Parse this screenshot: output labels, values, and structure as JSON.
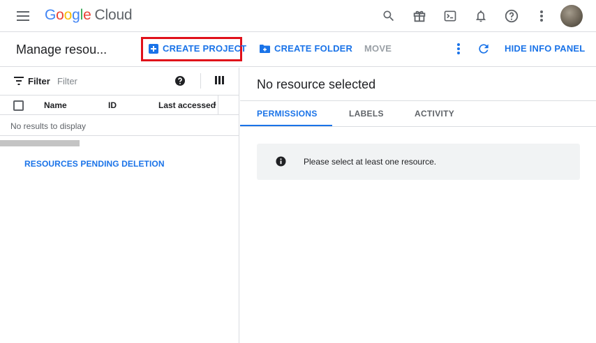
{
  "app": {
    "logo_letters": [
      "G",
      "o",
      "o",
      "g",
      "l",
      "e"
    ],
    "logo_suffix": "Cloud",
    "icons": [
      "menu-icon",
      "search-icon",
      "gift-icon",
      "terminal-icon",
      "bell-icon",
      "help-icon",
      "more-vert-icon",
      "avatar"
    ]
  },
  "actionbar": {
    "page_title": "Manage resou...",
    "create_project_label": "CREATE PROJECT",
    "create_folder_label": "CREATE FOLDER",
    "move_label": "MOVE",
    "hide_info_label": "HIDE INFO PANEL"
  },
  "left": {
    "filter_label": "Filter",
    "filter_placeholder": "Filter",
    "columns": [
      "Name",
      "ID",
      "Last accessed"
    ],
    "sort_glyph": "↓",
    "empty_text": "No results to display",
    "pending_deletion_label": "RESOURCES PENDING DELETION"
  },
  "right": {
    "title": "No resource selected",
    "tabs": [
      "PERMISSIONS",
      "LABELS",
      "ACTIVITY"
    ],
    "active_tab": "PERMISSIONS",
    "notice_text": "Please select at least one resource."
  },
  "colors": {
    "accent": "#1a73e8",
    "highlight_box": "#e0101a",
    "divider": "#dadce0"
  }
}
